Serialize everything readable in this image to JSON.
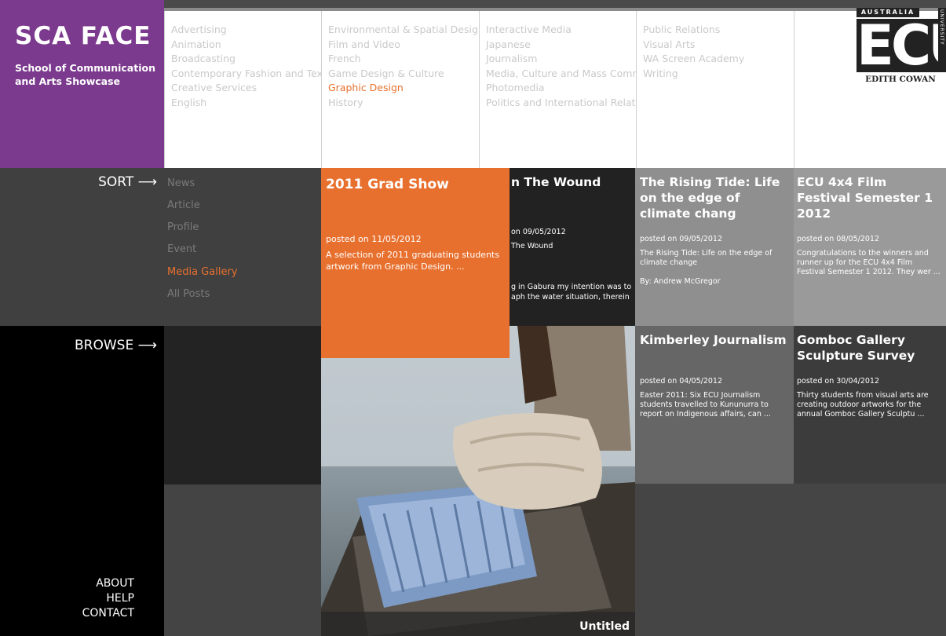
{
  "brand": {
    "title": "SCA FACE",
    "subtitle": "School of Communication and Arts Showcase"
  },
  "menu": {
    "col1": [
      "Advertising",
      "Animation",
      "Broadcasting",
      "Contemporary Fashion and Tex",
      "Creative Services",
      "English"
    ],
    "col2": [
      "Environmental & Spatial Design",
      "Film and Video",
      "French",
      "Game Design & Culture",
      "Graphic Design",
      "History"
    ],
    "col3": [
      "Interactive Media",
      "Japanese",
      "Journalism",
      "Media, Culture and Mass Comm",
      "Photomedia",
      "Politics and International Relati"
    ],
    "col4": [
      "Public Relations",
      "Visual Arts",
      "WA Screen Academy",
      "Writing"
    ],
    "active": "Graphic Design"
  },
  "logo": {
    "top": "AUSTRALIA",
    "mark": "ECU",
    "side": "UNIVERSITY",
    "bottom": "EDITH COWAN"
  },
  "sort": {
    "label": "SORT",
    "arrow": "⟶",
    "items": [
      "News",
      "Article",
      "Profile",
      "Event",
      "Media Gallery",
      "All Posts"
    ],
    "active": "Media Gallery"
  },
  "browse": {
    "label": "BROWSE",
    "arrow": "⟶"
  },
  "footer": {
    "about": "ABOUT",
    "help": "HELP",
    "contact": "CONTACT"
  },
  "tiles": {
    "grad": {
      "title": "2011 Grad Show",
      "date": "posted on 11/05/2012",
      "text": "A selection of 2011 graduating students artwork from Graphic Design. ..."
    },
    "wound": {
      "title": "n The Wound",
      "date": "on 09/05/2012",
      "text": "The Wound",
      "text2": "g in Gabura my intention was to aph the water situation, therein"
    },
    "rising": {
      "title": "The Rising Tide: Life on the edge of climate chang",
      "date": "posted on 09/05/2012",
      "text": "The Rising Tide: Life on the edge of climate change",
      "author": "By: Andrew McGregor"
    },
    "ecu": {
      "title": "ECU 4x4 Film Festival Semester 1 2012",
      "date": "posted on 08/05/2012",
      "text": "Congratulations to the winners and runner up for the ECU 4x4 Film Festival Semester 1 2012. They wer ..."
    },
    "kimberley": {
      "title": "Kimberley Journalism",
      "date": "posted on 04/05/2012",
      "text": "Easter 2011: Six ECU Journalism students travelled to Kununurra to report on Indigenous affairs, can ..."
    },
    "gomboc": {
      "title": "Gomboc Gallery Sculpture Survey",
      "date": "posted on 30/04/2012",
      "text": "Thirty students from visual arts are creating outdoor artworks for the annual Gomboc Gallery Sculptu ..."
    },
    "photo": {
      "caption": "Untitled"
    }
  },
  "colors": {
    "brand": "#7b3a8d",
    "accent": "#e8702e"
  }
}
